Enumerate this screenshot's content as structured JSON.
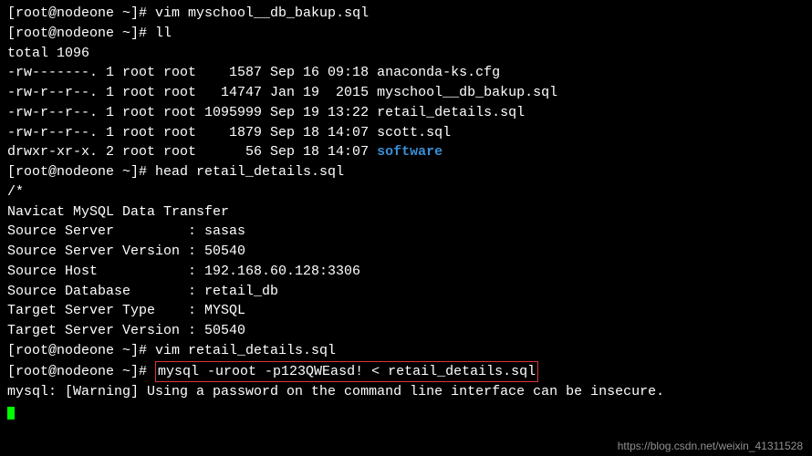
{
  "prompt": "[root@nodeone ~]# ",
  "lines": {
    "l1_cmd": "vim myschool__db_bakup.sql",
    "l2_cmd": "ll",
    "l3": "total 1096",
    "l4": "-rw-------. 1 root root    1587 Sep 16 09:18 anaconda-ks.cfg",
    "l5": "-rw-r--r--. 1 root root   14747 Jan 19  2015 myschool__db_bakup.sql",
    "l6": "-rw-r--r--. 1 root root 1095999 Sep 19 13:22 retail_details.sql",
    "l7": "-rw-r--r--. 1 root root    1879 Sep 18 14:07 scott.sql",
    "l8a": "drwxr-xr-x. 2 root root      56 Sep 18 14:07 ",
    "l8b": "software",
    "l9_cmd": "head retail_details.sql",
    "l10": "/*",
    "l11": "Navicat MySQL Data Transfer",
    "l12": "",
    "l13": "Source Server         : sasas",
    "l14": "Source Server Version : 50540",
    "l15": "Source Host           : 192.168.60.128:3306",
    "l16": "Source Database       : retail_db",
    "l17": "",
    "l18": "Target Server Type    : MYSQL",
    "l19": "Target Server Version : 50540",
    "l20_cmd": "vim retail_details.sql",
    "l21_cmd": "mysql -uroot -p123QWEasd! < retail_details.sql",
    "l22": "mysql: [Warning] Using a password on the command line interface can be insecure."
  },
  "watermark": "https://blog.csdn.net/weixin_41311528"
}
